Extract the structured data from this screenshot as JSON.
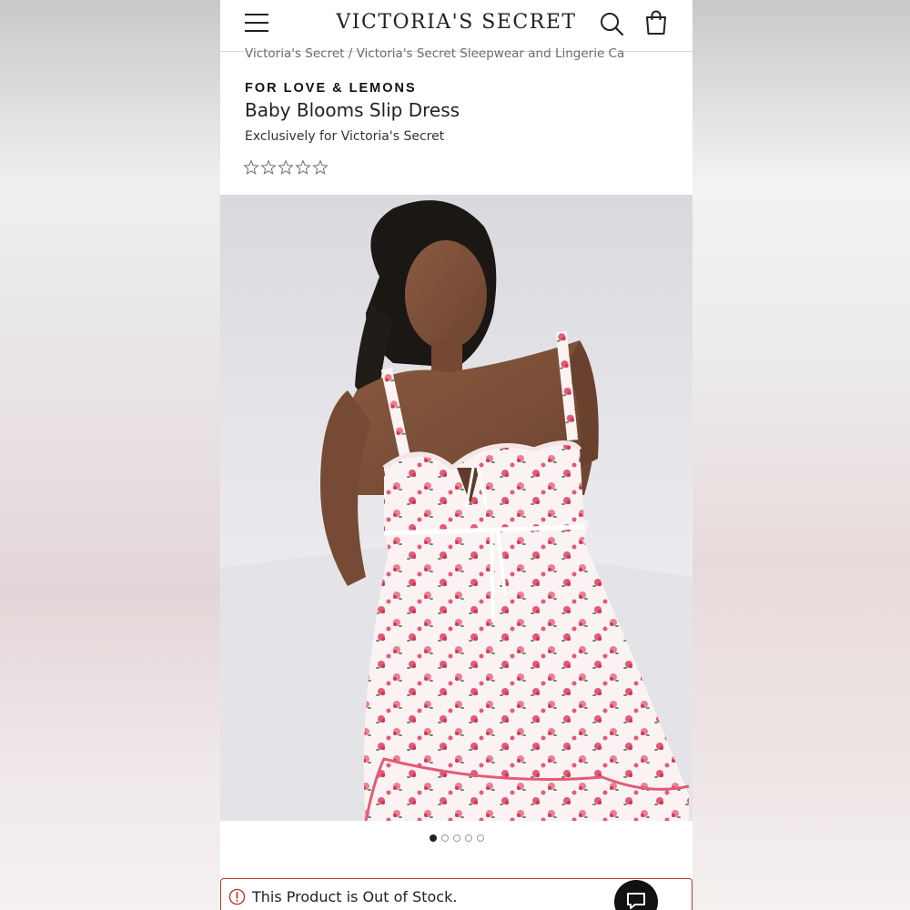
{
  "header": {
    "logo_text": "VICTORIA'S SECRET",
    "menu_icon": "hamburger-menu-icon",
    "search_icon": "search-icon",
    "bag_icon": "shopping-bag-icon"
  },
  "breadcrumb": {
    "items": [
      "Victoria's Secret",
      "Victoria's Secret Sleepwear and Lingerie Ca"
    ],
    "separator": "/"
  },
  "product": {
    "brand": "FOR LOVE & LEMONS",
    "name": "Baby Blooms Slip Dress",
    "exclusive_note": "Exclusively for Victoria's Secret",
    "rating_stars_total": 5,
    "rating_stars_filled": 0
  },
  "gallery": {
    "image_count": 5,
    "active_index": 0,
    "print_color": "#e25b78"
  },
  "stock_banner": {
    "message": "This Product is Out of Stock.",
    "accent_color": "#c0392b",
    "icon": "alert-circle-icon"
  },
  "chat": {
    "icon": "chat-bubble-icon"
  }
}
